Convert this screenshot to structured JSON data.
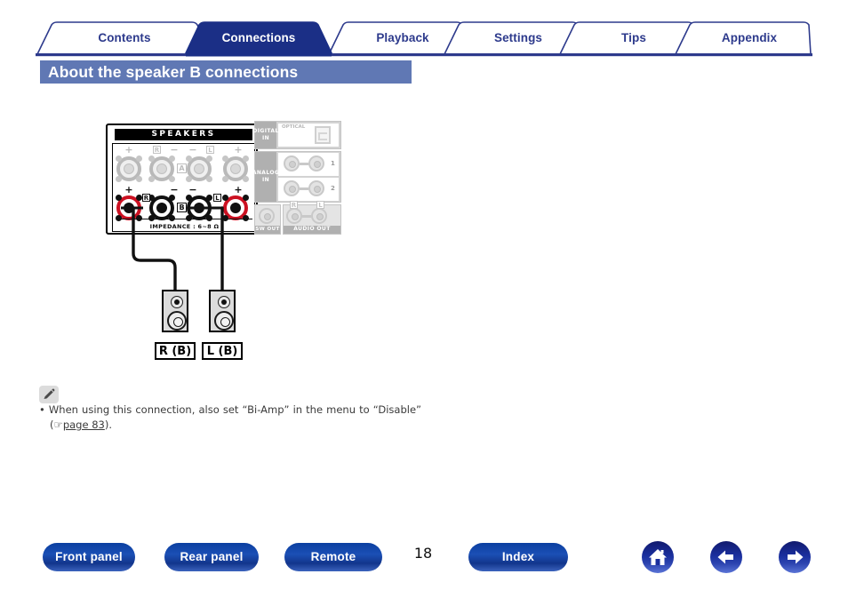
{
  "nav": {
    "tabs": [
      {
        "label": "Contents",
        "active": false
      },
      {
        "label": "Connections",
        "active": true
      },
      {
        "label": "Playback",
        "active": false
      },
      {
        "label": "Settings",
        "active": false
      },
      {
        "label": "Tips",
        "active": false
      },
      {
        "label": "Appendix",
        "active": false
      }
    ],
    "accent_color": "#2d3a8c",
    "active_tab_color": "#1b2f86"
  },
  "section": {
    "title": "About the speaker B connections",
    "bar_color": "#6078b4"
  },
  "diagram": {
    "panel_heading": "SPEAKERS",
    "impedance": "IMPEDANCE : 6~8 Ω",
    "terminals": {
      "row_a_label": "A",
      "row_b_label": "B",
      "channel_right": "R",
      "channel_left": "L",
      "plus": "+",
      "minus": "−"
    },
    "jacks": {
      "digital_in": "DIGITAL IN",
      "optical": "OPTICAL",
      "analog_in": "ANALOG IN",
      "analog_1": "1",
      "analog_2": "2",
      "out_right": "R",
      "out_left": "L",
      "sw_out": "SW OUT",
      "audio_out": "AUDIO OUT"
    },
    "speakers": [
      {
        "label": "R (B)"
      },
      {
        "label": "L (B)"
      }
    ]
  },
  "note": {
    "icon": "pencil-icon",
    "bullet": "•",
    "text_line1": "When using this connection, also set “Bi-Amp” in the menu to “Disable”",
    "open_paren": "(",
    "hand_icon": "☞",
    "link_text": "page 83",
    "close_paren": ")."
  },
  "footer": {
    "buttons": [
      {
        "label": "Front panel"
      },
      {
        "label": "Rear panel"
      },
      {
        "label": "Remote"
      },
      {
        "label": "Index"
      }
    ],
    "page_number": "18",
    "icons": [
      {
        "name": "home-icon"
      },
      {
        "name": "arrow-left-icon"
      },
      {
        "name": "arrow-right-icon"
      }
    ]
  }
}
